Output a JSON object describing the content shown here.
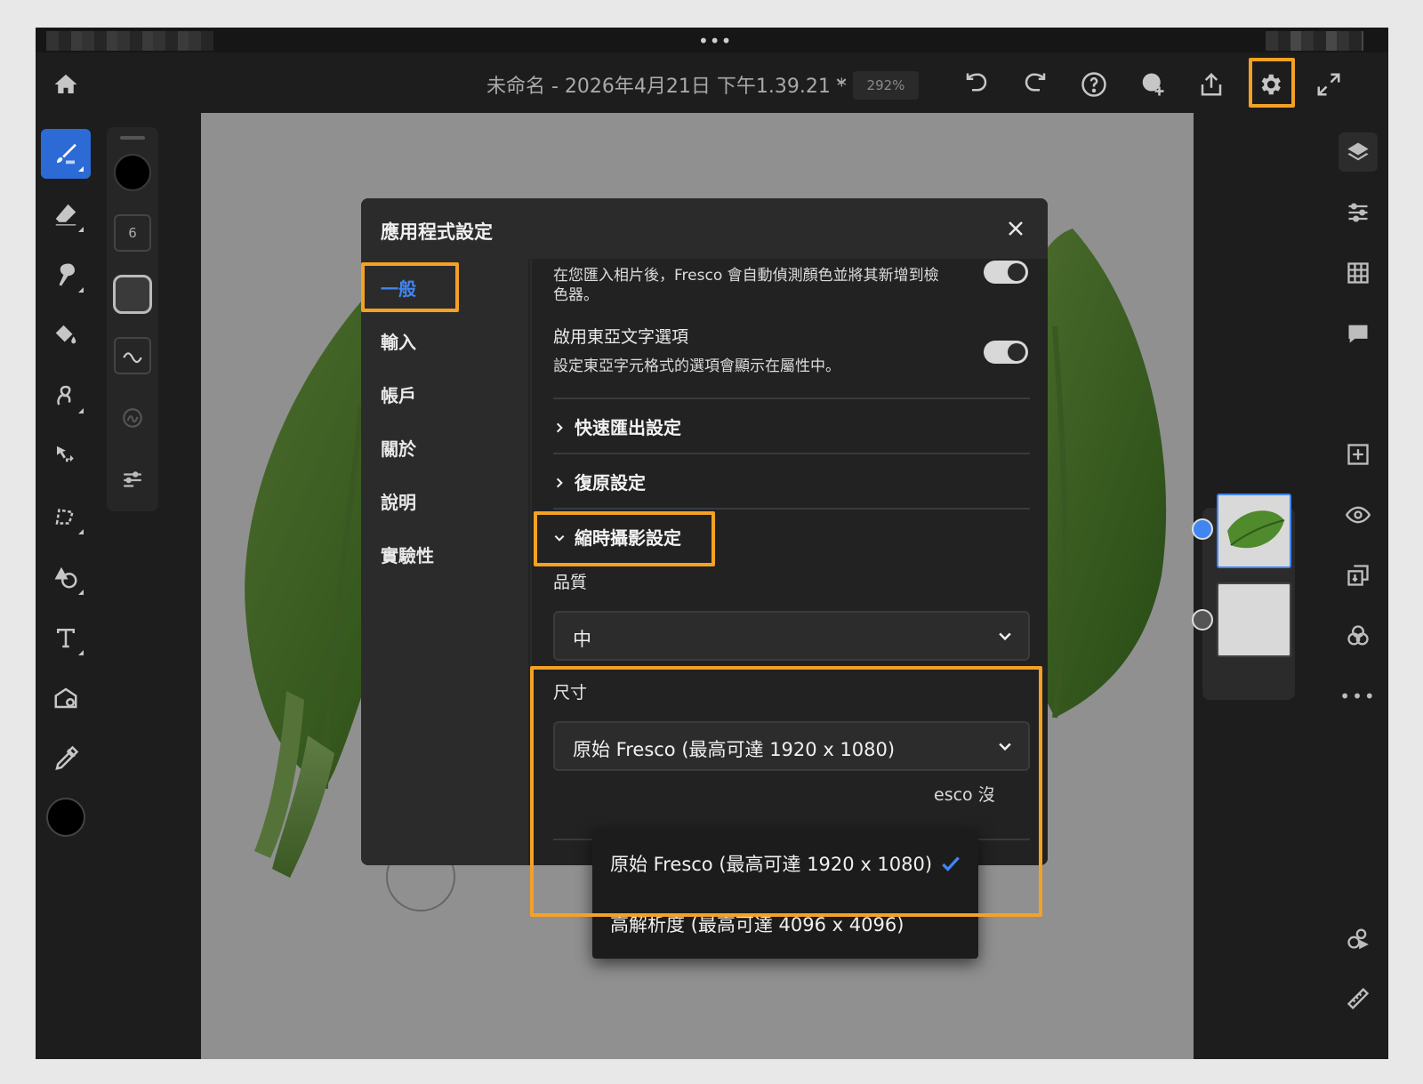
{
  "app": {
    "doc_title": "未命名 - 2026年4月21日 下午1.39.21 *",
    "zoom": "292%"
  },
  "toolbar": {
    "icons": [
      "home-icon",
      "chevron-down-icon",
      "undo-icon",
      "redo-icon",
      "help-icon",
      "invite-icon",
      "share-icon",
      "gear-icon",
      "fullscreen-icon"
    ]
  },
  "subtools": {
    "brush_size": "6"
  },
  "dialog": {
    "title": "應用程式設定",
    "nav": [
      {
        "label": "一般",
        "active": true
      },
      {
        "label": "輸入",
        "active": false
      },
      {
        "label": "帳戶",
        "active": false
      },
      {
        "label": "關於",
        "active": false
      },
      {
        "label": "說明",
        "active": false
      },
      {
        "label": "實驗性",
        "active": false
      }
    ],
    "content": {
      "photo_import_text": "在您匯入相片後，Fresco 會自動偵測顏色並將其新增到檢色器。",
      "photo_import_line1": "在您匯入相片後，Fresco 會自動偵測顏色並將其新增到檢",
      "photo_import_line2": "色器。",
      "east_asian_title": "啟用東亞文字選項",
      "east_asian_desc": "設定東亞字元格式的選項會顯示在屬性中。",
      "quick_export": "快速匯出設定",
      "restore": "復原設定",
      "timelapse": "縮時攝影設定",
      "quality_label": "品質",
      "quality_value": "中",
      "size_label": "尺寸",
      "size_value": "原始 Fresco (最高可達 1920 x 1080)",
      "partial_text": "esco 沒"
    },
    "dropdown": {
      "options": [
        {
          "label": "原始 Fresco (最高可達 1920 x 1080)",
          "selected": true
        },
        {
          "label": "高解析度 (最高可達 4096 x 4096)",
          "selected": false
        }
      ]
    }
  },
  "colors": {
    "accent": "#3f86f1",
    "highlight": "#f4a125",
    "toggle_on": "#d8d8d8"
  }
}
